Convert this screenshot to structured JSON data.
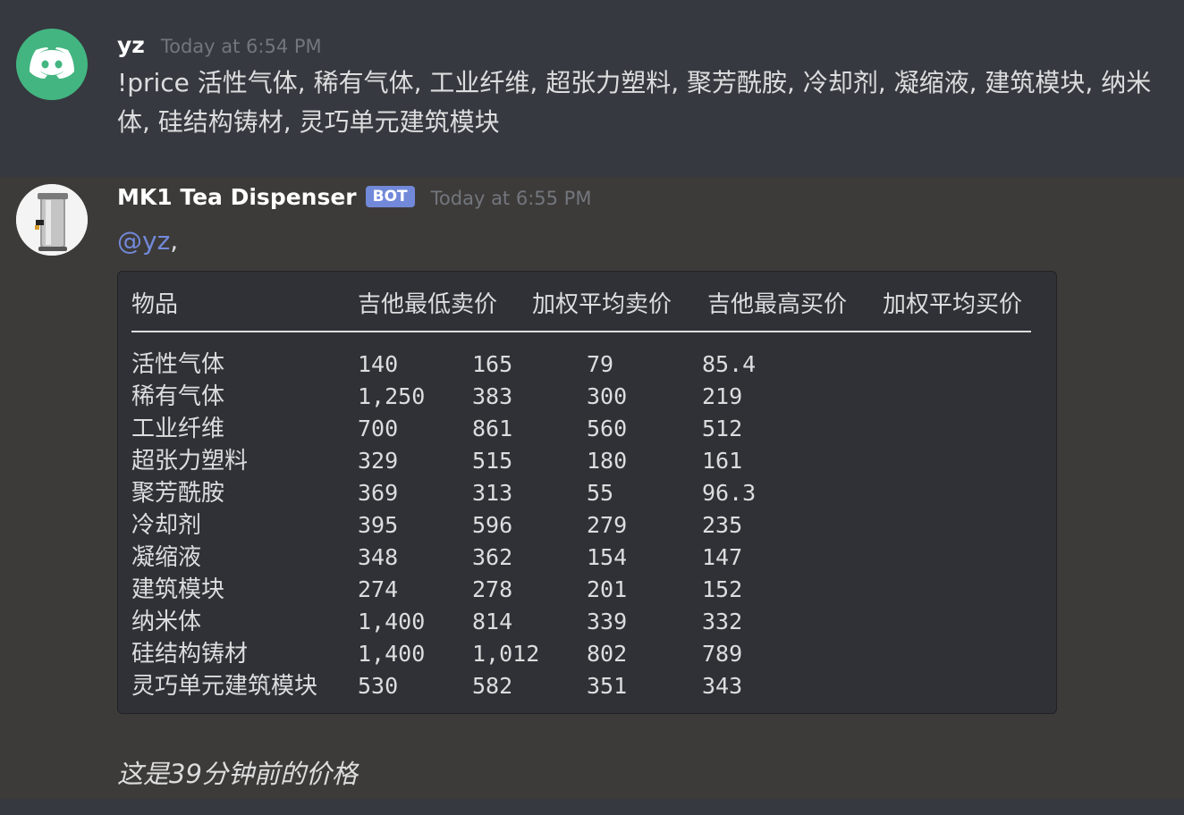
{
  "messages": [
    {
      "username": "yz",
      "timestamp": "Today at 6:54 PM",
      "text": "!price 活性气体, 稀有气体, 工业纤维, 超张力塑料, 聚芳酰胺, 冷却剂, 凝缩液, 建筑模块, 纳米体, 硅结构铸材, 灵巧单元建筑模块",
      "avatar_icon": "discord-logo-icon"
    },
    {
      "username": "MK1 Tea Dispenser",
      "badge": "BOT",
      "timestamp": "Today at 6:55 PM",
      "mention": "@yz",
      "mention_suffix": ",",
      "avatar_icon": "tea-dispenser-icon",
      "footer": "这是39分钟前的价格"
    }
  ],
  "price_table": {
    "headers": [
      "物品",
      "吉他最低卖价",
      "加权平均卖价",
      "吉他最高买价",
      "加权平均买价"
    ],
    "rows": [
      [
        "活性气体",
        "140",
        "165",
        "79",
        "85.4"
      ],
      [
        "稀有气体",
        "1,250",
        "383",
        "300",
        "219"
      ],
      [
        "工业纤维",
        "700",
        "861",
        "560",
        "512"
      ],
      [
        "超张力塑料",
        "329",
        "515",
        "180",
        "161"
      ],
      [
        "聚芳酰胺",
        "369",
        "313",
        "55",
        "96.3"
      ],
      [
        "冷却剂",
        "395",
        "596",
        "279",
        "235"
      ],
      [
        "凝缩液",
        "348",
        "362",
        "154",
        "147"
      ],
      [
        "建筑模块",
        "274",
        "278",
        "201",
        "152"
      ],
      [
        "纳米体",
        "1,400",
        "814",
        "339",
        "332"
      ],
      [
        "硅结构铸材",
        "1,400",
        "1,012",
        "802",
        "789"
      ],
      [
        "灵巧单元建筑模块",
        "530",
        "582",
        "351",
        "343"
      ]
    ]
  },
  "colors": {
    "background": "#36393f",
    "codeblock": "#2f3136",
    "mention": "#7289da",
    "bot_badge": "#7289da",
    "discord_green": "#43b581"
  }
}
